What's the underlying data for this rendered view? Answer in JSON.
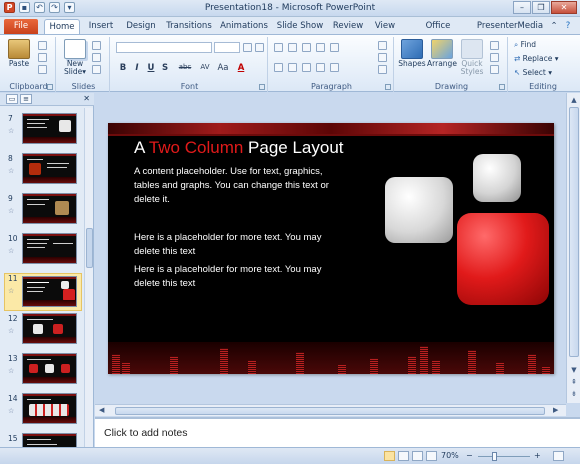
{
  "window": {
    "title": "Presentation18 - Microsoft PowerPoint",
    "app_icon": "P",
    "buttons": [
      "minimize-icon",
      "restore-icon",
      "close-icon"
    ]
  },
  "tabs": [
    "File",
    "Home",
    "Insert",
    "Design",
    "Transitions",
    "Animations",
    "Slide Show",
    "Review",
    "View",
    "Office Timeline+",
    "PresenterMedia"
  ],
  "ribbon": {
    "clipboard": {
      "paste": "Paste",
      "label": "Clipboard"
    },
    "slides": {
      "new_slide": "New Slide",
      "new_slide_arrow": "▾",
      "label": "Slides"
    },
    "font": {
      "bold": "B",
      "italic": "I",
      "underline": "U",
      "strike": "S",
      "shadow": "abc",
      "spacing": "AV",
      "case": "Aa",
      "color": "A",
      "label": "Font"
    },
    "paragraph": {
      "label": "Paragraph"
    },
    "drawing": {
      "shapes": "Shapes",
      "arrange": "Arrange",
      "quick_styles": "Quick Styles",
      "label": "Drawing"
    },
    "editing": {
      "find": "Find",
      "replace": "Replace",
      "select": "Select",
      "label": "Editing"
    }
  },
  "panel": {
    "slide_numbers": [
      "7",
      "8",
      "9",
      "10",
      "11",
      "12",
      "13",
      "14",
      "15"
    ],
    "selected": "11",
    "star": "☆"
  },
  "slide": {
    "title_part1": "A ",
    "title_part2": "Two Column",
    "title_part3": " Page Layout",
    "body1": "A content placeholder.  Use for text, graphics, tables and graphs.  You can change this text or delete it.",
    "body2": "Here is a placeholder for more text. You may delete this text",
    "body3": "Here is a placeholder for more text. You may delete this text"
  },
  "notes": {
    "placeholder": "Click to add notes"
  },
  "status": {
    "zoom": "70%",
    "minus": "−",
    "plus": "+"
  },
  "colors": {
    "accent_red": "#e11a1a",
    "file_tab": "#d24726",
    "slide_bg": "#000000"
  }
}
